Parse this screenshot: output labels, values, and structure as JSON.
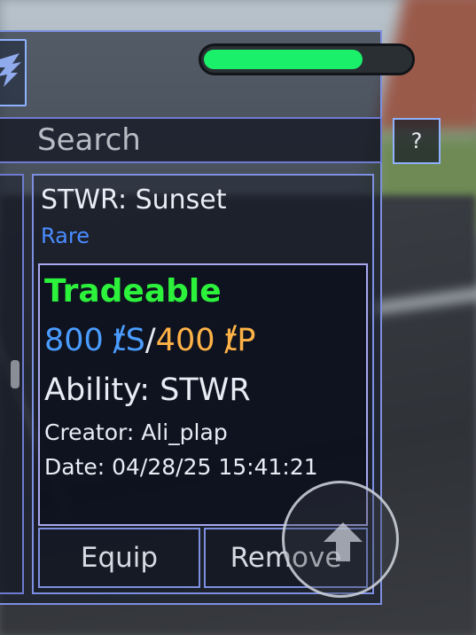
{
  "search": {
    "placeholder": "Search"
  },
  "help_button": {
    "label": "?"
  },
  "progress": {
    "fill_percent": 77,
    "color": "#1bf06a"
  },
  "item": {
    "name": "STWR: Sunset",
    "rarity": "Rare",
    "tradeable": "Tradeable",
    "price_s": "800 ⱦS",
    "price_separator": "/",
    "price_p": "400 ⱦP",
    "ability": "Ability: STWR",
    "creator": "Creator: Ali_plap",
    "date": "Date: 04/28/25 15:41:21"
  },
  "buttons": {
    "equip": "Equip",
    "remove": "Remove"
  },
  "colors": {
    "panel_border": "#7d8fe0",
    "rarity": "#4a8cff",
    "tradeable": "#2cf23c",
    "price_s": "#4a9cff",
    "price_p": "#ffb347"
  },
  "icons": {
    "logo": "wing-emblem-icon",
    "jump": "up-arrow-icon"
  }
}
